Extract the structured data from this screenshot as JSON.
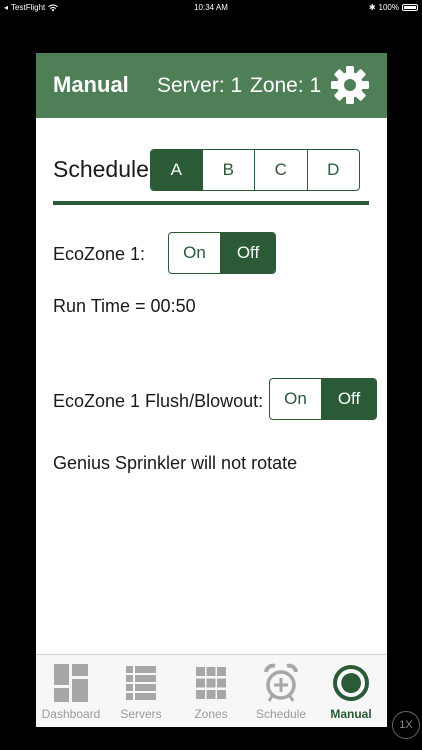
{
  "status": {
    "carrier": "TestFlight",
    "time": "10:34 AM",
    "battery": "100%"
  },
  "header": {
    "title": "Manual",
    "server": "Server: 1",
    "zone": "Zone: 1"
  },
  "schedule": {
    "label": "Schedule",
    "options": [
      "A",
      "B",
      "C",
      "D"
    ],
    "selected": "A"
  },
  "ecozone": {
    "label": "EcoZone 1:",
    "on": "On",
    "off": "Off",
    "selected": "Off"
  },
  "run_time": "Run Time = 00:50",
  "flush": {
    "label": "EcoZone 1 Flush/Blowout:",
    "on": "On",
    "off": "Off",
    "selected": "Off"
  },
  "message": "Genius Sprinkler will not rotate",
  "tabs": [
    {
      "label": "Dashboard",
      "icon": "dashboard-icon"
    },
    {
      "label": "Servers",
      "icon": "servers-icon"
    },
    {
      "label": "Zones",
      "icon": "zones-icon"
    },
    {
      "label": "Schedule",
      "icon": "alarm-clock-icon"
    },
    {
      "label": "Manual",
      "icon": "manual-icon"
    }
  ],
  "active_tab": "Manual",
  "zoom_badge": "1X",
  "colors": {
    "header": "#4f7f57",
    "accent": "#2a5a36",
    "inactive": "#9a9a9a"
  }
}
